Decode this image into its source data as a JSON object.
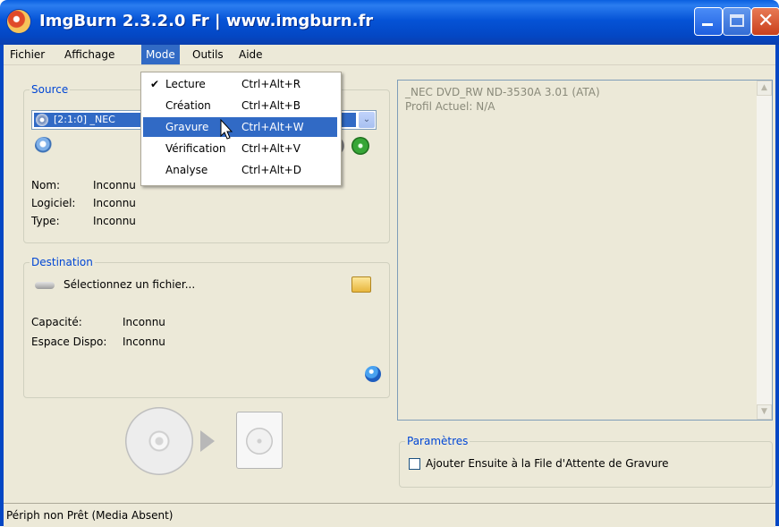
{
  "window": {
    "title": "ImgBurn 2.3.2.0 Fr | www.imgburn.fr",
    "minimize_glyph": "",
    "maximize_glyph": "",
    "close_glyph": "✕"
  },
  "menubar": {
    "items": [
      {
        "label": "Fichier"
      },
      {
        "label": "Affichage"
      },
      {
        "label": "Mode",
        "active": true
      },
      {
        "label": "Outils"
      },
      {
        "label": "Aide"
      }
    ]
  },
  "mode_menu": {
    "items": [
      {
        "label": "Lecture",
        "shortcut": "Ctrl+Alt+R",
        "checked": true
      },
      {
        "label": "Création",
        "shortcut": "Ctrl+Alt+B"
      },
      {
        "label": "Gravure",
        "shortcut": "Ctrl+Alt+W",
        "highlighted": true
      },
      {
        "label": "Vérification",
        "shortcut": "Ctrl+Alt+V"
      },
      {
        "label": "Analyse",
        "shortcut": "Ctrl+Alt+D"
      }
    ],
    "check_glyph": "✔"
  },
  "source": {
    "label": "Source",
    "selected_drive": "[2:1:0] _NEC",
    "dropdown_arrow": "⌄",
    "info": [
      {
        "key": "Nom:",
        "value": "Inconnu"
      },
      {
        "key": "Logiciel:",
        "value": "Inconnu"
      },
      {
        "key": "Type:",
        "value": "Inconnu"
      }
    ]
  },
  "destination": {
    "label": "Destination",
    "file_placeholder": "Sélectionnez un fichier...",
    "info": [
      {
        "key": "Capacité:",
        "value": "Inconnu"
      },
      {
        "key": "Espace Dispo:",
        "value": "Inconnu"
      }
    ]
  },
  "drive_info": {
    "lines": [
      "_NEC DVD_RW ND-3530A 3.01 (ATA)",
      "Profil Actuel: N/A"
    ]
  },
  "settings": {
    "label": "Paramètres",
    "checkbox_label": "Ajouter Ensuite à la File d'Attente de Gravure",
    "checked": false
  },
  "statusbar": {
    "text": "Périph non Prêt  (Media Absent)"
  },
  "icons": {
    "title_icon": "imgburn-disc-icon",
    "search": "magnifier-icon",
    "eject": "eject-icon",
    "folder": "folder-icon",
    "info": "info-globe-icon"
  }
}
